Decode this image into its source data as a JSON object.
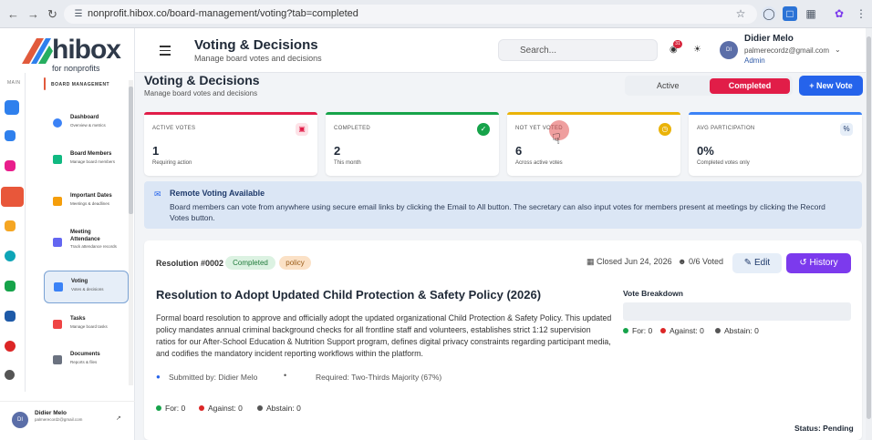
{
  "browser": {
    "url": "nonprofit.hibox.co/board-management/voting?tab=completed"
  },
  "brand": {
    "name": "hibox",
    "tagline": "for nonprofits"
  },
  "rail": {
    "main_label": "MAIN"
  },
  "sidebar": {
    "section_title": "BOARD MANAGEMENT",
    "items": [
      {
        "title": "Dashboard",
        "sub": "Overview & metrics",
        "color": "#3b82f6"
      },
      {
        "title": "Board Members",
        "sub": "Manage board members",
        "color": "#10b981"
      },
      {
        "title": "Important Dates",
        "sub": "Meetings & deadlines",
        "color": "#f59e0b"
      },
      {
        "title": "Meeting Attendance",
        "sub": "Track attendance records",
        "color": "#6366f1"
      },
      {
        "title": "Voting",
        "sub": "Votes & decisions",
        "color": "#3b82f6"
      },
      {
        "title": "Tasks",
        "sub": "Manage board tasks",
        "color": "#ef4444"
      },
      {
        "title": "Documents",
        "sub": "Reports & files",
        "color": "#6b7280"
      }
    ],
    "user": {
      "initials": "DI",
      "name": "Didier Melo",
      "email": "palmerecordz@gmail.com"
    }
  },
  "header": {
    "title": "Voting & Decisions",
    "subtitle": "Manage board votes and decisions",
    "search_placeholder": "Search...",
    "notifications": "31",
    "user": {
      "initials": "DI",
      "name": "Didier Melo",
      "email": "palmerecordz@gmail.com",
      "role": "Admin"
    }
  },
  "main": {
    "title": "Voting & Decisions",
    "subtitle": "Manage board votes and decisions",
    "tabs": {
      "active": "Active",
      "completed": "Completed"
    },
    "new_vote": "+ New Vote",
    "stats": [
      {
        "label": "ACTIVE VOTES",
        "value": "1",
        "sub": "Requiring action",
        "color": "#e11d48"
      },
      {
        "label": "COMPLETED",
        "value": "2",
        "sub": "This month",
        "color": "#16a34a"
      },
      {
        "label": "NOT YET VOTED",
        "value": "6",
        "sub": "Across active votes",
        "color": "#eab308"
      },
      {
        "label": "AVG PARTICIPATION",
        "value": "0%",
        "sub": "Completed votes only",
        "color": "#3b82f6"
      }
    ],
    "info": {
      "title": "Remote Voting Available",
      "body": "Board members can vote from anywhere using secure email links by clicking the Email to All button. The secretary can also input votes for members present at meetings by clicking the Record Votes button."
    },
    "resolution": {
      "id": "Resolution #0002",
      "status_badge": "Completed",
      "tag": "policy",
      "closed": "Closed Jun 24, 2026",
      "voted": "0/6 Voted",
      "edit": "Edit",
      "history": "History",
      "title": "Resolution to Adopt Updated Child Protection & Safety Policy (2026)",
      "description": "Formal board resolution to approve and officially adopt the updated organizational Child Protection & Safety Policy. This updated policy mandates annual criminal background checks for all frontline staff and volunteers, establishes strict 1:12 supervision ratios for our After-School Education & Nutrition Support program, defines digital privacy constraints regarding participant media, and codifies the mandatory incident reporting workflows within the platform.",
      "submitted_by": "Submitted by: Didier Melo",
      "separator": "•",
      "required": "Required: Two-Thirds Majority (67%)",
      "breakdown_title": "Vote Breakdown",
      "tally": {
        "for": "For: 0",
        "against": "Against: 0",
        "abstain": "Abstain: 0"
      },
      "status": "Status: Pending"
    }
  }
}
